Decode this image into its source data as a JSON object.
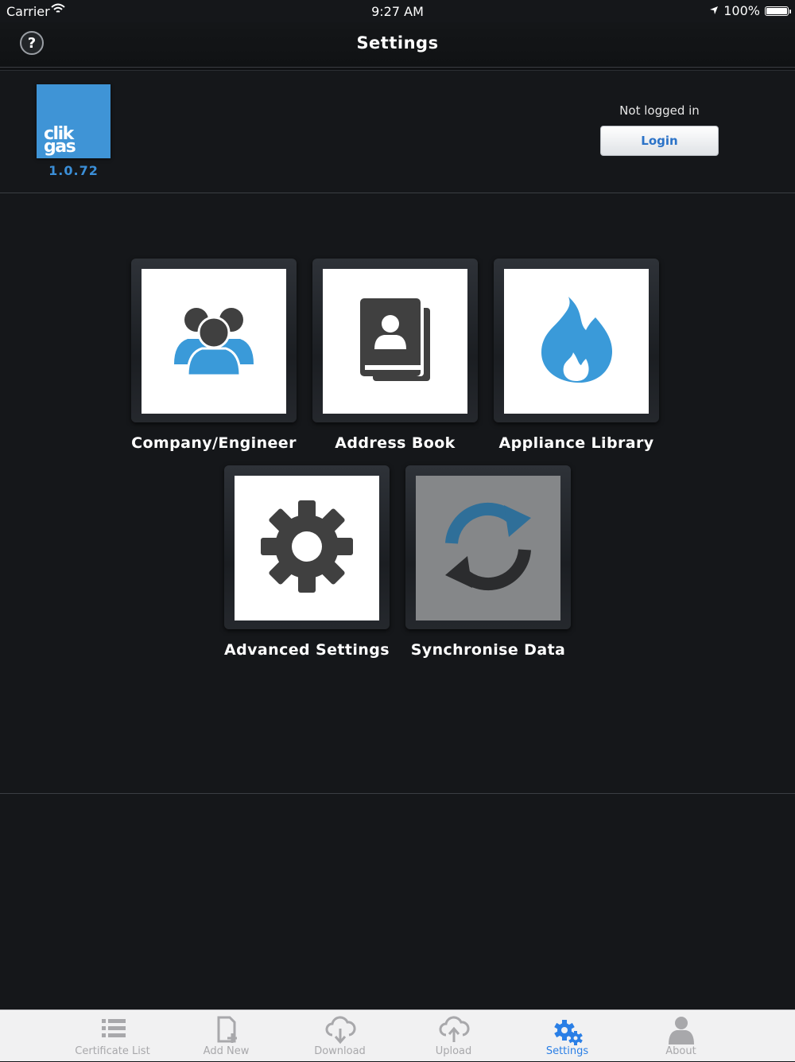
{
  "status_bar": {
    "carrier": "Carrier",
    "time": "9:27 AM",
    "battery": "100%",
    "battery_level": 1.0
  },
  "navbar": {
    "title": "Settings",
    "help_label": "?"
  },
  "header": {
    "logo_line1": "clik",
    "logo_line2": "gas",
    "version": "1.0.72",
    "login_status": "Not logged in",
    "login_label": "Login"
  },
  "tiles": [
    {
      "label": "Company/Engineer",
      "icon": "users-icon"
    },
    {
      "label": "Address Book",
      "icon": "address-book-icon"
    },
    {
      "label": "Appliance Library",
      "icon": "flame-icon"
    },
    {
      "label": "Advanced Settings",
      "icon": "gear-icon"
    },
    {
      "label": "Synchronise Data",
      "icon": "sync-icon",
      "disabled": true
    }
  ],
  "tabbar": {
    "items": [
      {
        "label": "Certificate List",
        "icon": "list-icon"
      },
      {
        "label": "Add New",
        "icon": "add-document-icon"
      },
      {
        "label": "Download",
        "icon": "cloud-download-icon"
      },
      {
        "label": "Upload",
        "icon": "cloud-upload-icon"
      },
      {
        "label": "Settings",
        "icon": "gears-icon",
        "active": true
      },
      {
        "label": "About",
        "icon": "person-icon"
      }
    ]
  },
  "colors": {
    "background": "#15171a",
    "accent": "#2a7fe6",
    "logo": "#3f94d6",
    "icon_blue": "#3a9ad9",
    "icon_dark": "#404040"
  }
}
